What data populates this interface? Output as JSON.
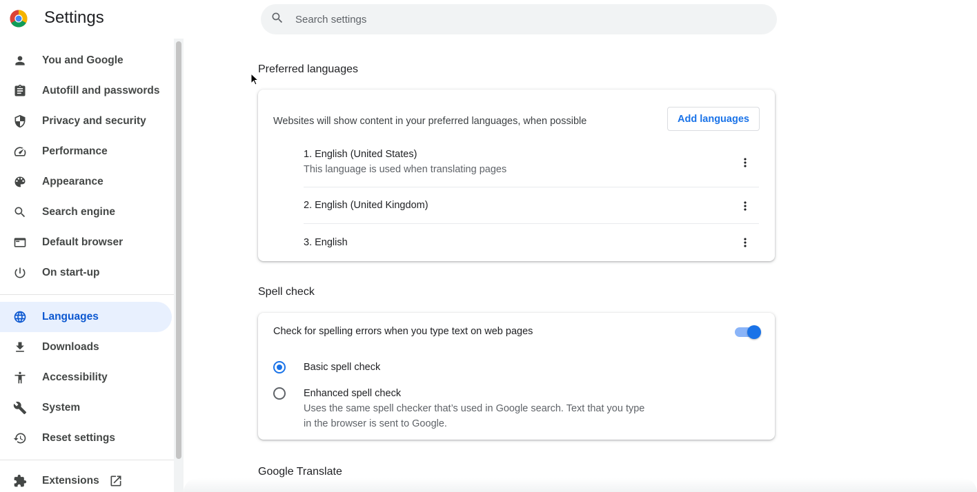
{
  "header": {
    "title": "Settings",
    "search_placeholder": "Search settings"
  },
  "sidebar": {
    "items": [
      {
        "label": "You and Google",
        "icon": "person-icon"
      },
      {
        "label": "Autofill and passwords",
        "icon": "clipboard-icon"
      },
      {
        "label": "Privacy and security",
        "icon": "shield-icon"
      },
      {
        "label": "Performance",
        "icon": "speedometer-icon"
      },
      {
        "label": "Appearance",
        "icon": "palette-icon"
      },
      {
        "label": "Search engine",
        "icon": "search-icon"
      },
      {
        "label": "Default browser",
        "icon": "browser-window-icon"
      },
      {
        "label": "On start-up",
        "icon": "power-icon"
      },
      {
        "label": "Languages",
        "icon": "globe-icon",
        "active": true
      },
      {
        "label": "Downloads",
        "icon": "download-icon"
      },
      {
        "label": "Accessibility",
        "icon": "accessibility-icon"
      },
      {
        "label": "System",
        "icon": "wrench-icon"
      },
      {
        "label": "Reset settings",
        "icon": "history-icon"
      }
    ],
    "extensions": {
      "label": "Extensions",
      "icon": "puzzle-icon",
      "open_icon": "open-in-new-icon"
    }
  },
  "preferred_languages": {
    "title": "Preferred languages",
    "description": "Websites will show content in your preferred languages, when possible",
    "add_button": "Add languages",
    "languages": [
      {
        "name": "1. English (United States)",
        "note": "This language is used when translating pages"
      },
      {
        "name": "2. English (United Kingdom)"
      },
      {
        "name": "3. English"
      }
    ]
  },
  "spell_check": {
    "title": "Spell check",
    "toggle_label": "Check for spelling errors when you type text on web pages",
    "toggle_on": true,
    "options": [
      {
        "label": "Basic spell check",
        "checked": true
      },
      {
        "label": "Enhanced spell check",
        "description": "Uses the same spell checker that’s used in Google search. Text that you type in the browser is sent to Google.",
        "checked": false
      }
    ]
  },
  "google_translate": {
    "title": "Google Translate"
  },
  "colors": {
    "accent": "#1a73e8",
    "active_nav_bg": "#e8f0fe",
    "active_nav_text": "#0b57d0"
  }
}
